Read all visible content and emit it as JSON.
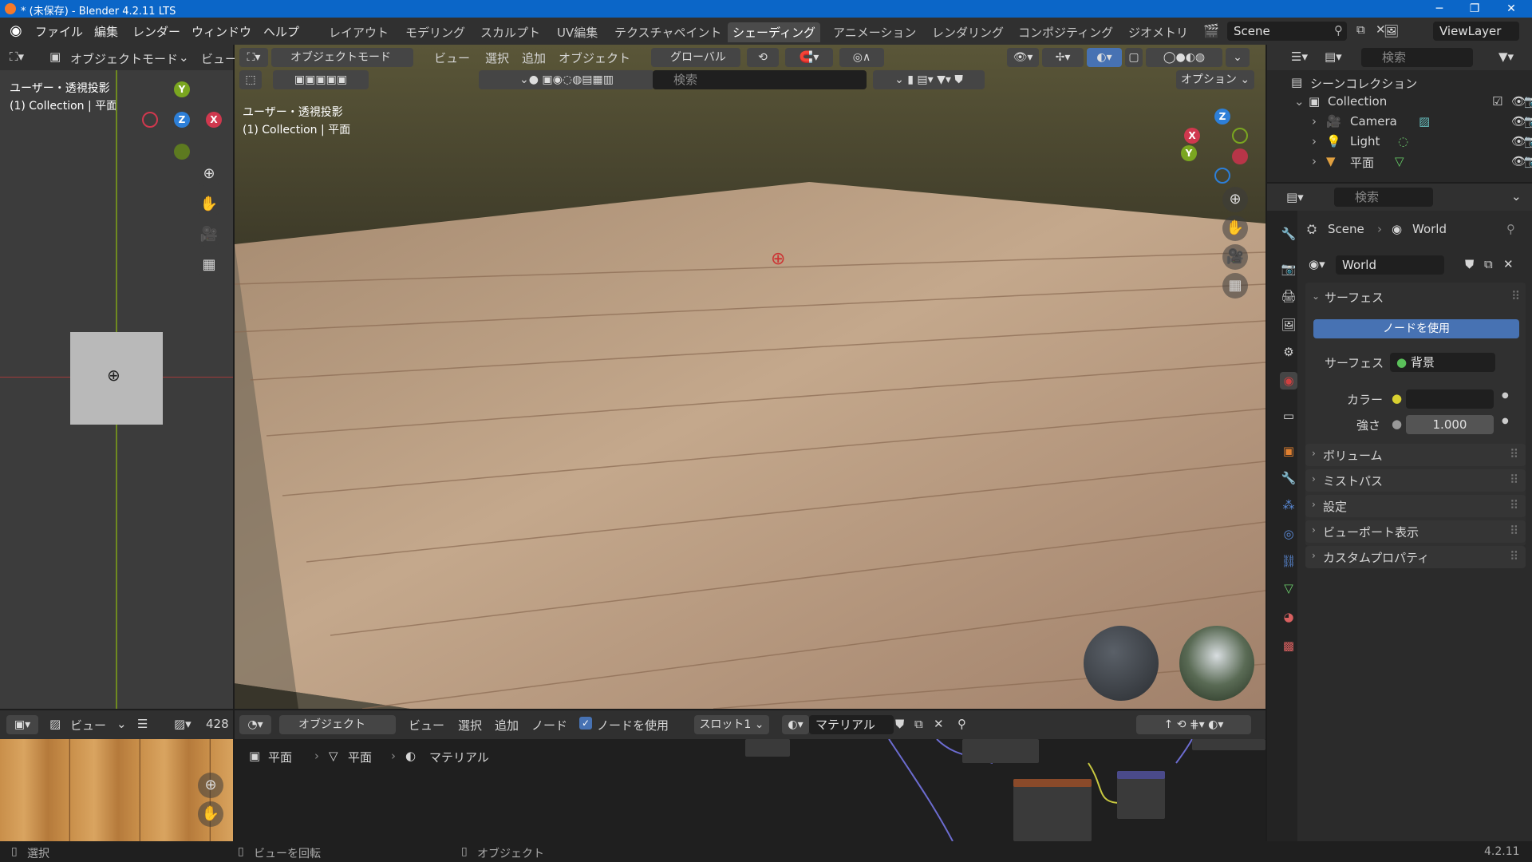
{
  "window": {
    "title": "* (未保存) - Blender 4.2.11 LTS",
    "minimize": "─",
    "maximize": "❐",
    "close": "✕"
  },
  "menu": {
    "items": [
      "ファイル",
      "編集",
      "レンダー",
      "ウィンドウ",
      "ヘルプ"
    ]
  },
  "workspaces": [
    "レイアウト",
    "モデリング",
    "スカルプト",
    "UV編集",
    "テクスチャペイント",
    "シェーディング",
    "アニメーション",
    "レンダリング",
    "コンポジティング",
    "ジオメトリ"
  ],
  "active_workspace": "シェーディング",
  "scene": {
    "label": "Scene",
    "viewlayer": "ViewLayer"
  },
  "left_viewport": {
    "mode": "オブジェクトモード",
    "view_menu": "ビュー",
    "info_line1": "ユーザー・透視投影",
    "info_line2": "(1) Collection | 平面"
  },
  "main_viewport": {
    "mode": "オブジェクトモード",
    "menus": [
      "ビュー",
      "選択",
      "追加",
      "オブジェクト"
    ],
    "transform": "グローバル",
    "search_placeholder": "検索",
    "options": "オプション",
    "info_line1": "ユーザー・透視投影",
    "info_line2": "(1) Collection | 平面"
  },
  "image_editor": {
    "view": "ビュー",
    "zoom_value": "428"
  },
  "node_editor": {
    "type": "オブジェクト",
    "menus": [
      "ビュー",
      "選択",
      "追加",
      "ノード"
    ],
    "use_nodes_label": "ノードを使用",
    "slot": "スロット1",
    "material": "マテリアル",
    "breadcrumb": [
      "平面",
      "平面",
      "マテリアル"
    ]
  },
  "outliner": {
    "search_placeholder": "検索",
    "scene_collection": "シーンコレクション",
    "collection": "Collection",
    "items": [
      "Camera",
      "Light",
      "平面"
    ]
  },
  "properties": {
    "search_placeholder": "検索",
    "breadcrumb_scene": "Scene",
    "breadcrumb_world": "World",
    "world_name": "World",
    "surface_section": "サーフェス",
    "use_nodes_button": "ノードを使用",
    "surface_label": "サーフェス",
    "surface_value": "背景",
    "color_label": "カラー",
    "strength_label": "強さ",
    "strength_value": "1.000",
    "collapsed_sections": [
      "ボリューム",
      "ミストパス",
      "設定",
      "ビューポート表示",
      "カスタムプロパティ"
    ]
  },
  "status_bar": {
    "select": "選択",
    "rotate": "ビューを回転",
    "object": "オブジェクト",
    "version": "4.2.11"
  },
  "colors": {
    "title_bar": "#0b66c8",
    "accent_blue": "#4772b3",
    "wood_light": "#b8977a",
    "wood_dark": "#8a6a50"
  }
}
